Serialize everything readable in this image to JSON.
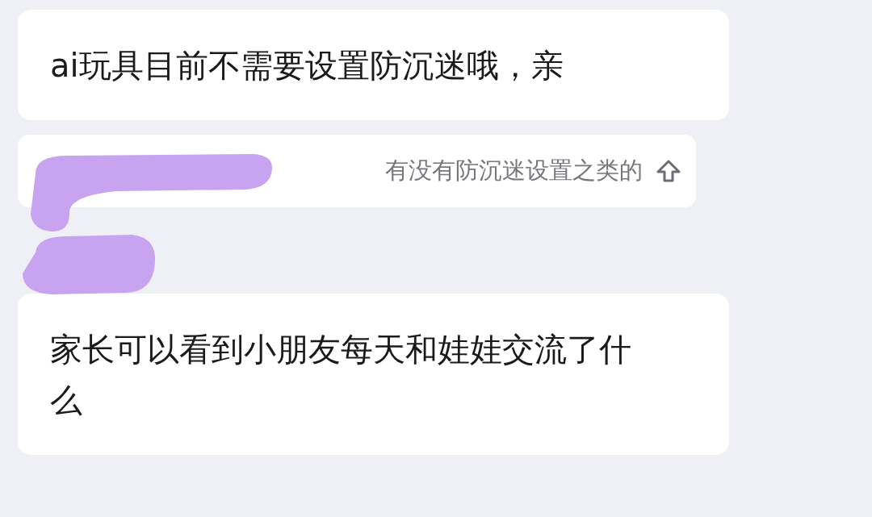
{
  "messages": [
    {
      "kind": "bubble",
      "text": "ai玩具目前不需要设置防沉迷哦，亲"
    },
    {
      "kind": "quote",
      "text": "有没有防沉迷设置之类的"
    },
    {
      "kind": "bubble",
      "text": "家长可以看到小朋友每天和娃娃交流了什么"
    }
  ]
}
